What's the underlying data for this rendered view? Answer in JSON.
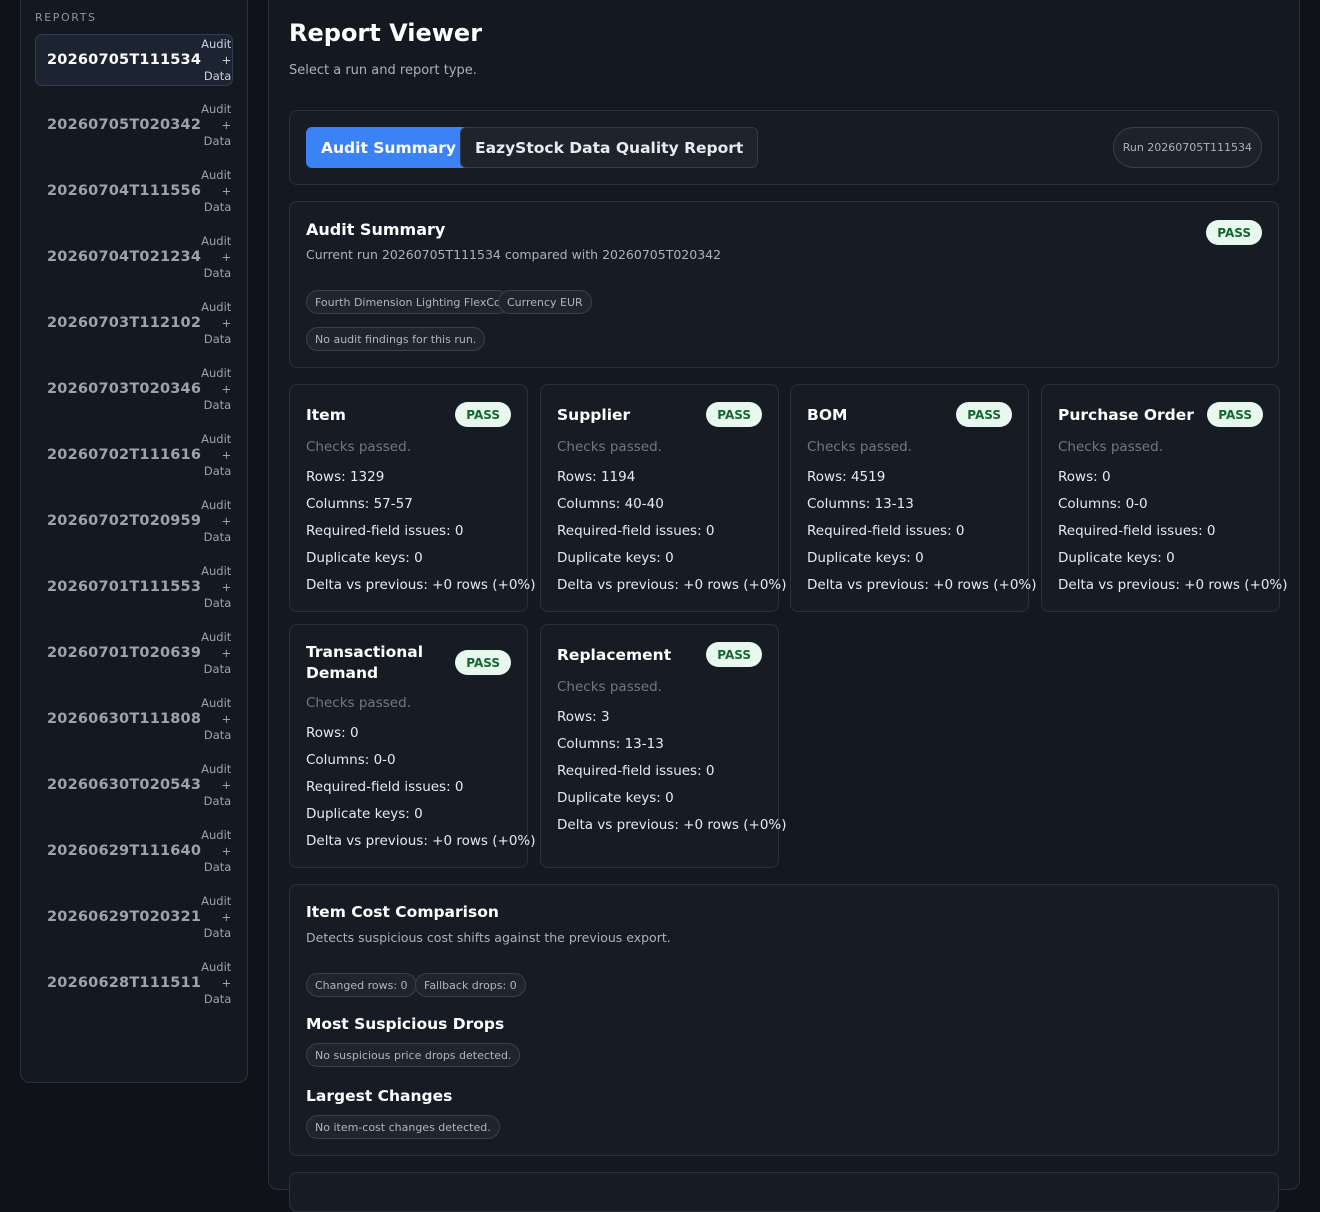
{
  "sidebar": {
    "title": "REPORTS",
    "items": [
      {
        "id": "20260705T111534",
        "kind": "Audit + Data"
      },
      {
        "id": "20260705T020342",
        "kind": "Audit + Data"
      },
      {
        "id": "20260704T111556",
        "kind": "Audit + Data"
      },
      {
        "id": "20260704T021234",
        "kind": "Audit + Data"
      },
      {
        "id": "20260703T112102",
        "kind": "Audit + Data"
      },
      {
        "id": "20260703T020346",
        "kind": "Audit + Data"
      },
      {
        "id": "20260702T111616",
        "kind": "Audit + Data"
      },
      {
        "id": "20260702T020959",
        "kind": "Audit + Data"
      },
      {
        "id": "20260701T111553",
        "kind": "Audit + Data"
      },
      {
        "id": "20260701T020639",
        "kind": "Audit + Data"
      },
      {
        "id": "20260630T111808",
        "kind": "Audit + Data"
      },
      {
        "id": "20260630T020543",
        "kind": "Audit + Data"
      },
      {
        "id": "20260629T111640",
        "kind": "Audit + Data"
      },
      {
        "id": "20260629T020321",
        "kind": "Audit + Data"
      },
      {
        "id": "20260628T111511",
        "kind": "Audit + Data"
      }
    ]
  },
  "header": {
    "title": "Report Viewer",
    "subtitle": "Select a run and report type."
  },
  "tabs": {
    "audit": "Audit Summary",
    "quality": "EazyStock Data Quality Report",
    "run_pill": "Run 20260705T111534"
  },
  "summary": {
    "title": "Audit Summary",
    "status": "PASS",
    "description": "Current run 20260705T111534 compared with 20260705T020342",
    "chips": [
      "Fourth Dimension Lighting FlexCo",
      "Currency EUR"
    ],
    "findings": "No audit findings for this run."
  },
  "cards": [
    {
      "title": "Item",
      "status": "PASS",
      "note": "Checks passed.",
      "rows": "Rows: 1329",
      "columns": "Columns: 57-57",
      "required": "Required-field issues: 0",
      "duplicates": "Duplicate keys: 0",
      "delta": "Delta vs previous: +0 rows (+0%)"
    },
    {
      "title": "Supplier",
      "status": "PASS",
      "note": "Checks passed.",
      "rows": "Rows: 1194",
      "columns": "Columns: 40-40",
      "required": "Required-field issues: 0",
      "duplicates": "Duplicate keys: 0",
      "delta": "Delta vs previous: +0 rows (+0%)"
    },
    {
      "title": "BOM",
      "status": "PASS",
      "note": "Checks passed.",
      "rows": "Rows: 4519",
      "columns": "Columns: 13-13",
      "required": "Required-field issues: 0",
      "duplicates": "Duplicate keys: 0",
      "delta": "Delta vs previous: +0 rows (+0%)"
    },
    {
      "title": "Purchase Order",
      "status": "PASS",
      "note": "Checks passed.",
      "rows": "Rows: 0",
      "columns": "Columns: 0-0",
      "required": "Required-field issues: 0",
      "duplicates": "Duplicate keys: 0",
      "delta": "Delta vs previous: +0 rows (+0%)"
    },
    {
      "title": "Transactional Demand",
      "status": "PASS",
      "note": "Checks passed.",
      "rows": "Rows: 0",
      "columns": "Columns: 0-0",
      "required": "Required-field issues: 0",
      "duplicates": "Duplicate keys: 0",
      "delta": "Delta vs previous: +0 rows (+0%)"
    },
    {
      "title": "Replacement",
      "status": "PASS",
      "note": "Checks passed.",
      "rows": "Rows: 3",
      "columns": "Columns: 13-13",
      "required": "Required-field issues: 0",
      "duplicates": "Duplicate keys: 0",
      "delta": "Delta vs previous: +0 rows (+0%)"
    }
  ],
  "cost": {
    "title": "Item Cost Comparison",
    "description": "Detects suspicious cost shifts against the previous export.",
    "chips": [
      "Changed rows: 0",
      "Fallback drops: 0"
    ],
    "drops_title": "Most Suspicious Drops",
    "drops_empty": "No suspicious price drops detected.",
    "changes_title": "Largest Changes",
    "changes_empty": "No item-cost changes detected."
  }
}
